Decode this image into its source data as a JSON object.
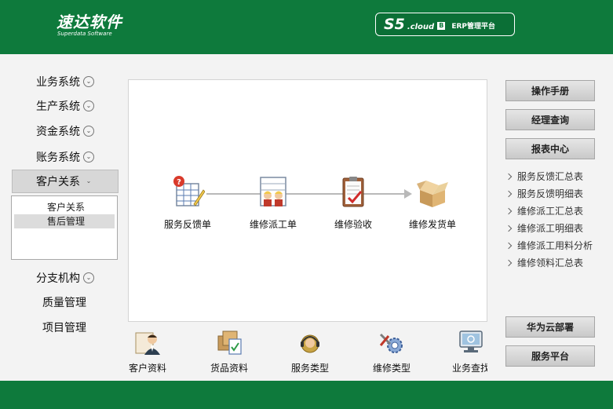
{
  "header": {
    "logo_cn": "速达软件",
    "logo_en": "Superdata Software",
    "brand_s5": "S5",
    "brand_cloud": ".cloud",
    "brand_badge": "B",
    "brand_erp": "ERP管理平台"
  },
  "sidebar": {
    "items": [
      {
        "label": "业务系统",
        "chevron": "⌄"
      },
      {
        "label": "生产系统",
        "chevron": "⌄"
      },
      {
        "label": "资金系统",
        "chevron": "⌄"
      },
      {
        "label": "账务系统",
        "chevron": "⌄"
      },
      {
        "label": "客户关系",
        "chevron": "⌄"
      },
      {
        "label": "分支机构",
        "chevron": "⌄"
      },
      {
        "label": "质量管理"
      },
      {
        "label": "项目管理"
      }
    ],
    "submenu": [
      "客户关系",
      "售后管理"
    ]
  },
  "flow": {
    "nodes": [
      {
        "label": "服务反馈单",
        "icon": "feedback-form-icon"
      },
      {
        "label": "维修派工单",
        "icon": "dispatch-workers-icon"
      },
      {
        "label": "维修验收",
        "icon": "clipboard-check-icon"
      },
      {
        "label": "维修发货单",
        "icon": "open-box-icon"
      }
    ]
  },
  "tools": [
    {
      "label": "客户资料",
      "icon": "customer-profile-icon"
    },
    {
      "label": "货品资料",
      "icon": "goods-info-icon"
    },
    {
      "label": "服务类型",
      "icon": "headset-icon"
    },
    {
      "label": "维修类型",
      "icon": "repair-gear-icon"
    },
    {
      "label": "业务查找",
      "icon": "monitor-search-icon"
    }
  ],
  "right": {
    "buttons": [
      "操作手册",
      "经理查询",
      "报表中心"
    ],
    "reports": [
      "服务反馈汇总表",
      "服务反馈明细表",
      "维修派工汇总表",
      "维修派工明细表",
      "维修派工用料分析",
      "维修领料汇总表"
    ],
    "bottom_buttons": [
      "华为云部署",
      "服务平台"
    ]
  },
  "colors": {
    "brand_green": "#0e7a3c",
    "panel_gray": "#f3f3f3"
  }
}
